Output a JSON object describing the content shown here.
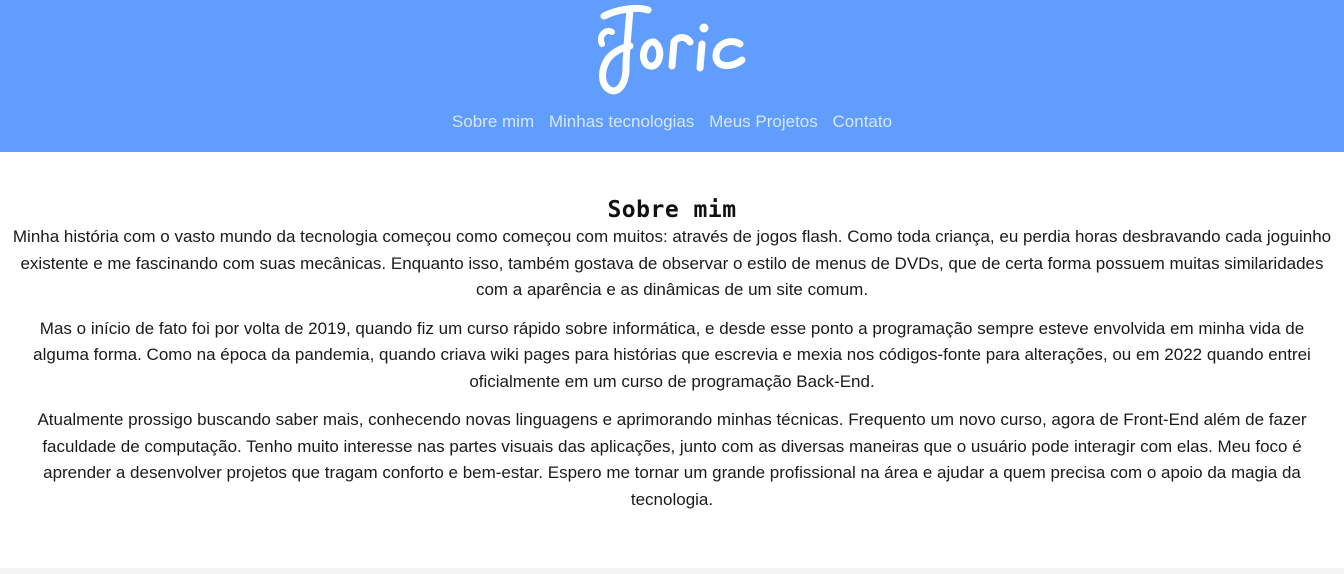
{
  "header": {
    "logo_text": "Joric",
    "nav": [
      "Sobre mim",
      "Minhas tecnologias",
      "Meus Projetos",
      "Contato"
    ]
  },
  "main": {
    "title": "Sobre mim",
    "paragraphs": [
      "Minha história com o vasto mundo da tecnologia começou como começou com muitos: através de jogos flash. Como toda criança, eu perdia horas desbravando cada joguinho existente e me fascinando com suas mecânicas. Enquanto isso, também gostava de observar o estilo de menus de DVDs, que de certa forma possuem muitas similaridades com a aparência e as dinâmicas de um site comum.",
      "Mas o início de fato foi por volta de 2019, quando fiz um curso rápido sobre informática, e desde esse ponto a programação sempre esteve envolvida em minha vida de alguma forma. Como na época da pandemia, quando criava wiki pages para histórias que escrevia e mexia nos códigos-fonte para alterações, ou em 2022 quando entrei oficialmente em um curso de programação Back-End.",
      "Atualmente prossigo buscando saber mais, conhecendo novas linguagens e aprimorando minhas técnicas. Frequento um novo curso, agora de Front-End além de fazer faculdade de computação. Tenho muito interesse nas partes visuais das aplicações, junto com as diversas maneiras que o usuário pode interagir com elas. Meu foco é aprender a desenvolver projetos que tragam conforto e bem-estar. Espero me tornar um grande profissional na área e ajudar a quem precisa com o apoio da magia da tecnologia."
    ]
  },
  "colors": {
    "header_bg": "#609dfd",
    "nav_link": "#d6e6ff",
    "logo": "#ffffff"
  }
}
